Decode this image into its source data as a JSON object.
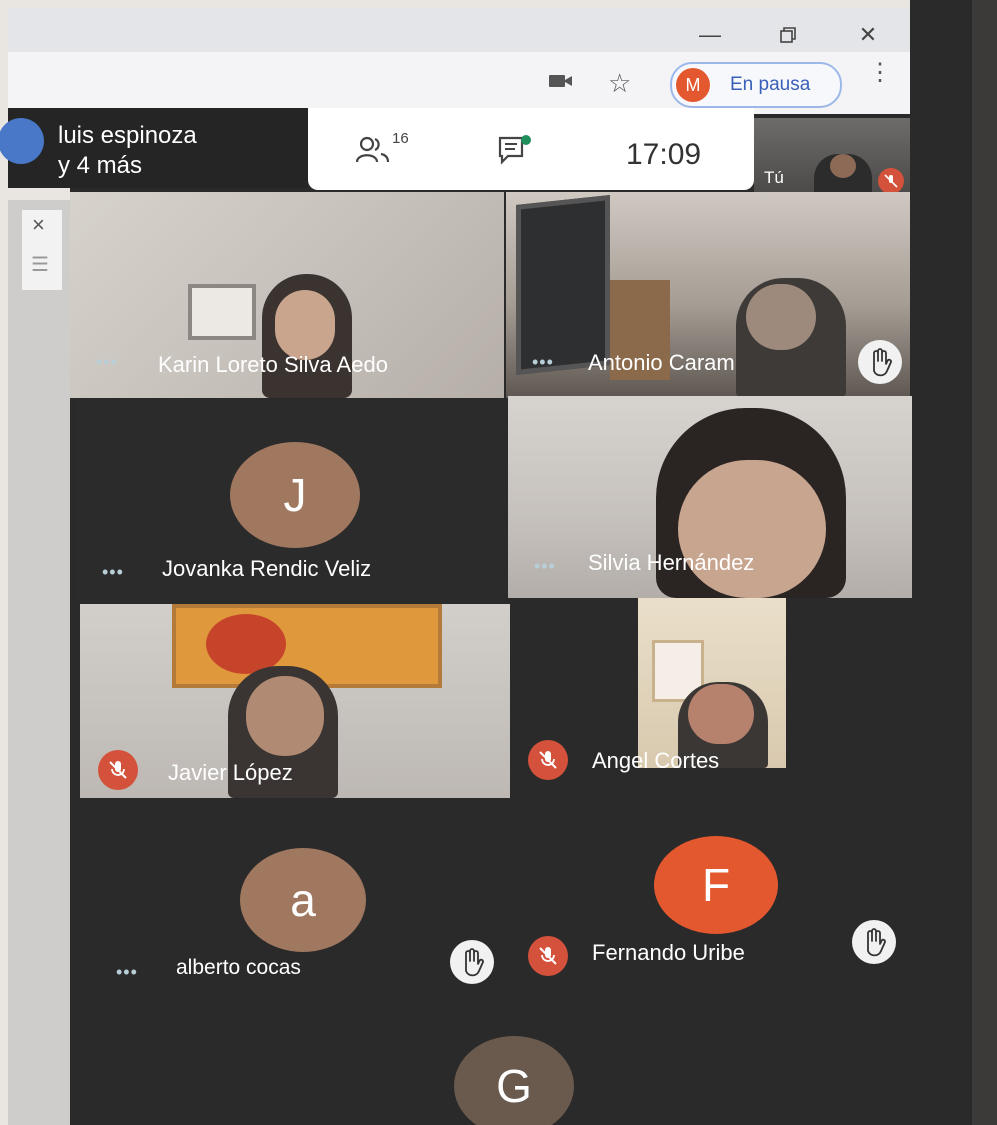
{
  "browser": {
    "profile_initial": "M",
    "pause_label": "En pausa"
  },
  "meeting": {
    "group_name_line1": "luis espinoza",
    "group_name_line2": "y 4 más",
    "participants_count": "16",
    "clock": "17:09",
    "self_label": "Tú"
  },
  "participants": [
    {
      "name": "Karin Loreto Silva Aedo"
    },
    {
      "name": "Antonio Caram"
    },
    {
      "name": "Jovanka Rendic Veliz",
      "initial": "J"
    },
    {
      "name": "Silvia Hernández"
    },
    {
      "name": "Javier López"
    },
    {
      "name": "Angel Cortes"
    },
    {
      "name": "alberto cocas",
      "initial": "a"
    },
    {
      "name": "Fernando Uribe",
      "initial": "F"
    },
    {
      "initial": "G"
    }
  ],
  "icons": {
    "more": "•••",
    "close": "×",
    "menu": "☰"
  },
  "colors": {
    "avatar_brown": "#a07860",
    "avatar_orange": "#e3582f",
    "avatar_dark": "#6a5a4e",
    "mic_off": "#d4513b",
    "tile_dark": "#2b2a2a"
  }
}
